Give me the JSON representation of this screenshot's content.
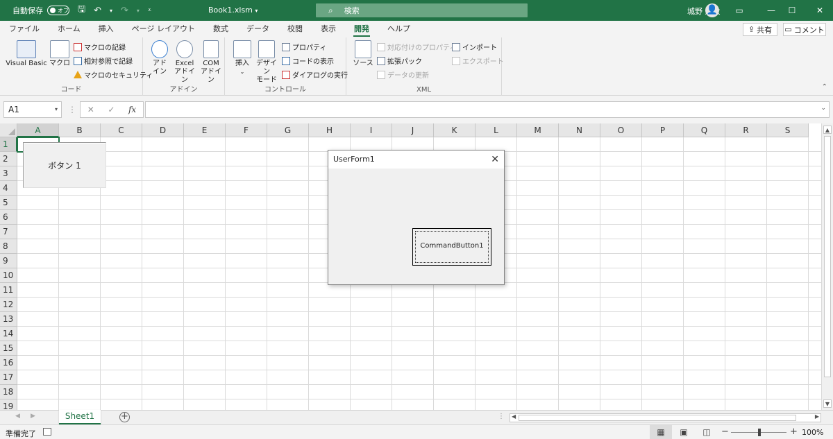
{
  "titlebar": {
    "autosave_label": "自動保存",
    "autosave_state": "オフ",
    "doc_title": "Book1.xlsm",
    "doc_title_caret": "▾",
    "search_placeholder": "検索",
    "user_name": "城野 達太"
  },
  "tabs": [
    "ファイル",
    "ホーム",
    "挿入",
    "ページ レイアウト",
    "数式",
    "データ",
    "校閲",
    "表示",
    "開発",
    "ヘルプ"
  ],
  "active_tab": "開発",
  "share_label": "共有",
  "comment_label": "コメント",
  "ribbon": {
    "code": {
      "label": "コード",
      "visual_basic": "Visual Basic",
      "macro": "マクロ",
      "record_macro": "マクロの記録",
      "relative_ref": "相対参照で記録",
      "macro_security": "マクロのセキュリティ"
    },
    "addins": {
      "label": "アドイン",
      "addin_1": "アド",
      "addin_2": "イン",
      "excel_addin_1": "Excel",
      "excel_addin_2": "アドイン",
      "com_addin_1": "COM",
      "com_addin_2": "アドイン"
    },
    "controls": {
      "label": "コントロール",
      "insert": "挿入",
      "insert_caret": "⌄",
      "design_mode_1": "デザイン",
      "design_mode_2": "モード",
      "properties": "プロパティ",
      "view_code": "コードの表示",
      "run_dialog": "ダイアログの実行"
    },
    "xml": {
      "label": "XML",
      "source": "ソース",
      "map_properties": "対応付けのプロパティ",
      "expansion_packs": "拡張パック",
      "refresh_data": "データの更新",
      "import": "インポート",
      "export": "エクスポート"
    }
  },
  "formula_bar": {
    "name_box": "A1",
    "fx": "fx",
    "cancel": "✕",
    "enter": "✓",
    "value": ""
  },
  "columns": [
    "A",
    "B",
    "C",
    "D",
    "E",
    "F",
    "G",
    "H",
    "I",
    "J",
    "K",
    "L",
    "M",
    "N",
    "O",
    "P",
    "Q",
    "R",
    "S"
  ],
  "rows": [
    "1",
    "2",
    "3",
    "4",
    "5",
    "6",
    "7",
    "8",
    "9",
    "10",
    "11",
    "12",
    "13",
    "14",
    "15",
    "16",
    "17",
    "18",
    "19"
  ],
  "sheet_button_label": "ボタン 1",
  "userform": {
    "title": "UserForm1",
    "close": "✕",
    "command_button": "CommandButton1"
  },
  "sheets": [
    "Sheet1"
  ],
  "add_sheet": "+",
  "status": {
    "ready": "準備完了",
    "zoom": "100%",
    "zoom_minus": "−",
    "zoom_plus": "+"
  },
  "colors": {
    "brand": "#217346",
    "ribbon_bg": "#f3f3f3"
  }
}
